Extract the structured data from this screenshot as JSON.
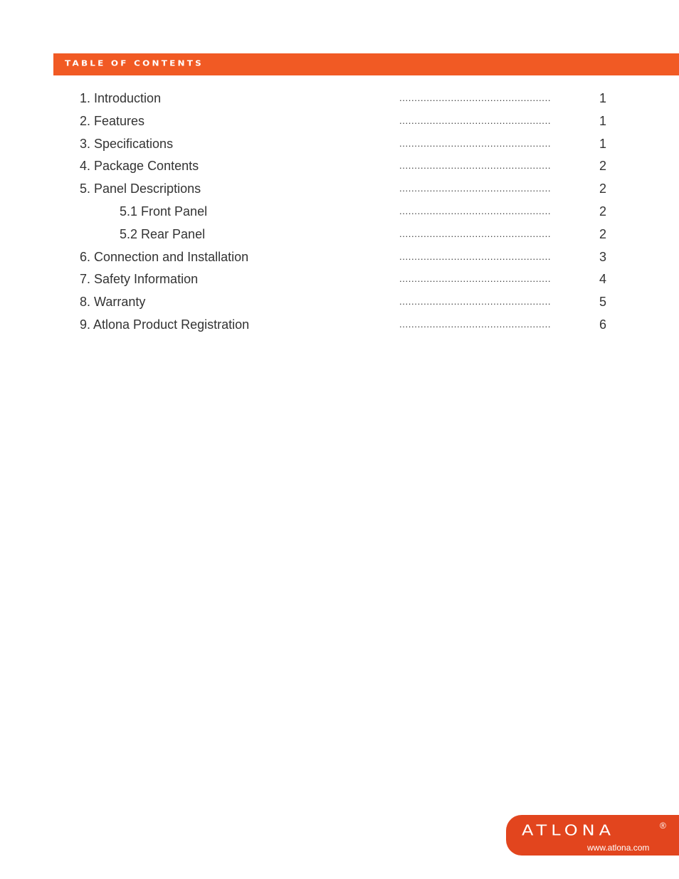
{
  "header": {
    "title": "TABLE OF CONTENTS",
    "accent_color": "#f15a24"
  },
  "toc": [
    {
      "label": "1. Introduction",
      "page": "1",
      "level": 1
    },
    {
      "label": "2. Features",
      "page": "1",
      "level": 1
    },
    {
      "label": "3. Specifications",
      "page": "1",
      "level": 1
    },
    {
      "label": "4. Package Contents",
      "page": "2",
      "level": 1
    },
    {
      "label": "5. Panel Descriptions",
      "page": "2",
      "level": 1
    },
    {
      "label": "5.1 Front Panel",
      "page": "2",
      "level": 2
    },
    {
      "label": "5.2 Rear Panel",
      "page": "2",
      "level": 2
    },
    {
      "label": "6. Connection and Installation",
      "page": "3",
      "level": 1
    },
    {
      "label": "7. Safety Information",
      "page": "4",
      "level": 1
    },
    {
      "label": "8. Warranty",
      "page": "5",
      "level": 1
    },
    {
      "label": "9. Atlona Product Registration",
      "page": "6",
      "level": 1
    }
  ],
  "leader": "..................................................",
  "footer": {
    "brand": "ATLONA",
    "registered": "®",
    "url": "www.atlona.com",
    "color": "#e2451e"
  }
}
